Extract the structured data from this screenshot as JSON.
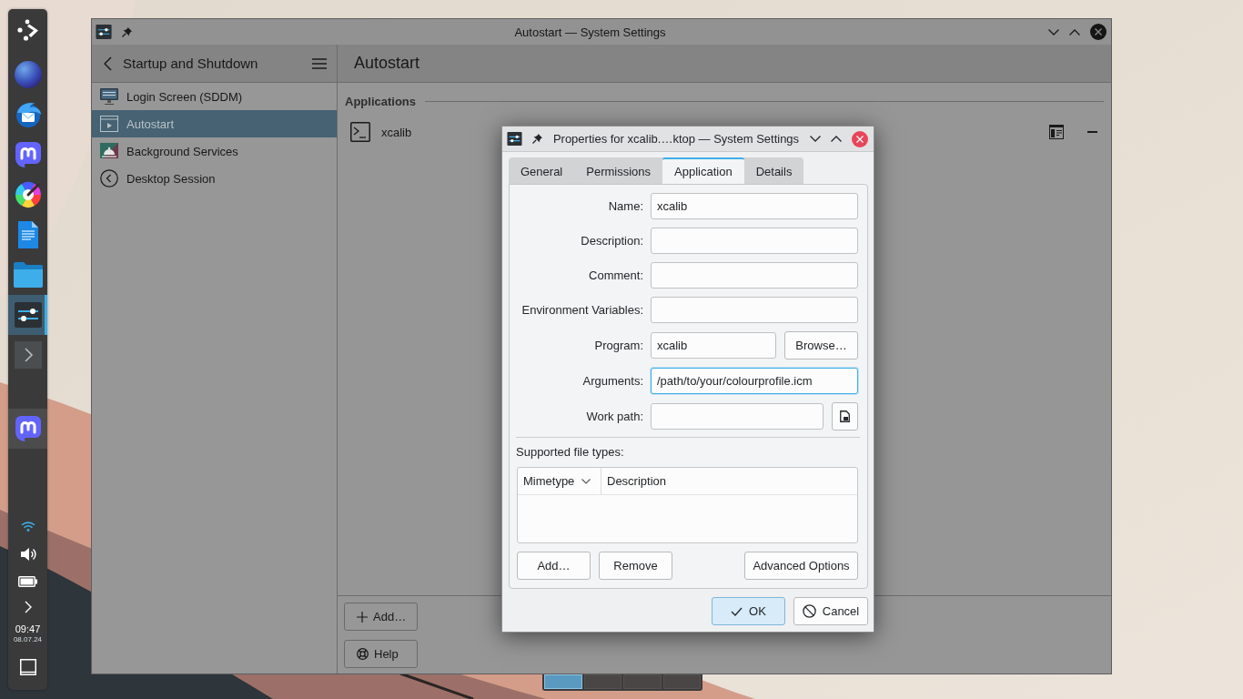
{
  "panel": {
    "items": [
      {
        "kind": "launcher",
        "selected": false,
        "highlighted": false
      },
      {
        "kind": "globe",
        "selected": false,
        "highlighted": false
      },
      {
        "kind": "bird",
        "selected": false,
        "highlighted": false
      },
      {
        "kind": "bubble",
        "selected": false,
        "highlighted": false
      },
      {
        "kind": "wheel",
        "selected": false,
        "highlighted": false
      },
      {
        "kind": "document",
        "selected": false,
        "highlighted": false
      },
      {
        "kind": "folder",
        "selected": false,
        "highlighted": false
      },
      {
        "kind": "sliders",
        "selected": true,
        "highlighted": false
      },
      {
        "kind": "terminal",
        "selected": false,
        "highlighted": false
      }
    ],
    "tasks": [
      {
        "kind": "bubble",
        "selected": false,
        "highlighted": true
      }
    ],
    "clock": {
      "time": "09:47",
      "date": "08.07.24"
    }
  },
  "pager": {
    "desktops": [
      {
        "selected": true
      },
      {
        "selected": false
      },
      {
        "selected": false
      },
      {
        "selected": false
      }
    ]
  },
  "main_window": {
    "title": "Autostart — System Settings",
    "dimmed": true,
    "sidebar": {
      "title": "Startup and Shutdown",
      "items": [
        {
          "label": "Login Screen (SDDM)",
          "kind": "display",
          "selected": false
        },
        {
          "label": "Autostart",
          "kind": "startup",
          "selected": true
        },
        {
          "label": "Background Services",
          "kind": "service",
          "selected": false
        },
        {
          "label": "Desktop Session",
          "kind": "session",
          "selected": false
        }
      ]
    },
    "page": {
      "title": "Autostart",
      "section": "Applications",
      "entries": [
        {
          "name": "xcalib"
        }
      ],
      "buttons": [
        {
          "label": "Add…",
          "kind": "add"
        },
        {
          "label": "Help",
          "kind": "help"
        }
      ]
    }
  },
  "dialog": {
    "title": "Properties for xcalib.…ktop — System Settings",
    "tabs": [
      {
        "label": "General",
        "selected": false
      },
      {
        "label": "Permissions",
        "selected": false
      },
      {
        "label": "Application",
        "selected": true
      },
      {
        "label": "Details",
        "selected": false
      }
    ],
    "fields": [
      {
        "label": "Name:",
        "value": "xcalib",
        "kind": "text",
        "focused": false
      },
      {
        "label": "Description:",
        "kind": "text",
        "focused": false
      },
      {
        "label": "Comment:",
        "kind": "text",
        "focused": false
      },
      {
        "label": "Environment Variables:",
        "kind": "text",
        "focused": false
      },
      {
        "label": "Program:",
        "value": "xcalib",
        "kind": "browse",
        "button": "Browse…",
        "focused": false
      },
      {
        "label": "Arguments:",
        "value": "/path/to/your/colourprofile.icm",
        "kind": "text",
        "focused": true
      },
      {
        "label": "Work path:",
        "kind": "folder",
        "focused": false
      }
    ],
    "file_types": {
      "label": "Supported file types:",
      "columns": [
        {
          "label": "Mimetype",
          "sorted": true
        },
        {
          "label": "Description",
          "sorted": false
        }
      ],
      "buttons": [
        "Add…",
        "Remove",
        "Advanced Options"
      ]
    },
    "buttons": [
      {
        "label": "OK",
        "kind": "ok",
        "default": true
      },
      {
        "label": "Cancel",
        "kind": "cancel",
        "default": false
      }
    ]
  }
}
